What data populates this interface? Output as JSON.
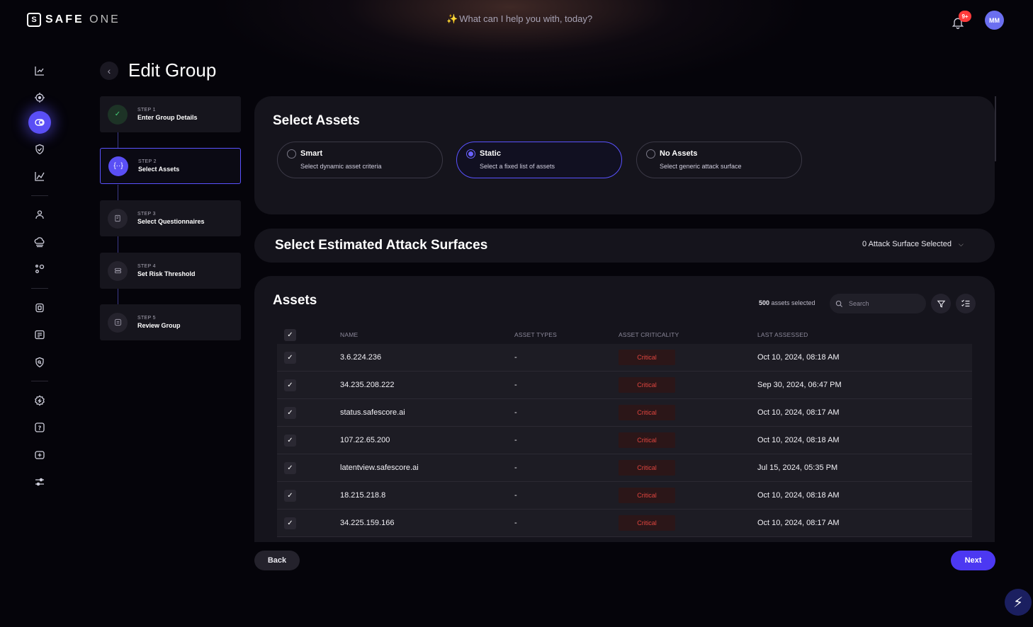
{
  "header": {
    "logo_bold": "SAFE",
    "logo_light": "ONE",
    "logo_mark": "S",
    "ask_placeholder": "What can I help you with, today?",
    "notifications_badge": "9+",
    "avatar_initials": "MM"
  },
  "sidebar": {
    "items": [
      {
        "icon": "chart-icon"
      },
      {
        "icon": "target-icon"
      },
      {
        "icon": "toggle-icon",
        "active": true
      },
      {
        "icon": "shield-check-icon"
      },
      {
        "icon": "trend-icon"
      },
      {
        "icon": "user-icon"
      },
      {
        "icon": "cloud-icon"
      },
      {
        "icon": "nodes-icon"
      },
      {
        "icon": "chip-icon"
      },
      {
        "icon": "list-icon"
      },
      {
        "icon": "shield-search-icon"
      },
      {
        "icon": "settings-icon"
      },
      {
        "icon": "help-icon"
      },
      {
        "icon": "add-box-icon"
      },
      {
        "icon": "sliders-icon"
      }
    ]
  },
  "page": {
    "title": "Edit Group"
  },
  "steps": [
    {
      "num": "STEP 1",
      "name": "Enter Group Details",
      "state": "done"
    },
    {
      "num": "STEP 2",
      "name": "Select Assets",
      "state": "current"
    },
    {
      "num": "STEP 3",
      "name": "Select Questionnaires",
      "state": "pending"
    },
    {
      "num": "STEP 4",
      "name": "Set Risk Threshold",
      "state": "pending"
    },
    {
      "num": "STEP 5",
      "name": "Review Group",
      "state": "pending"
    }
  ],
  "select_assets": {
    "title": "Select Assets",
    "options": [
      {
        "title": "Smart",
        "desc": "Select dynamic asset criteria",
        "selected": false
      },
      {
        "title": "Static",
        "desc": "Select a fixed list of assets",
        "selected": true
      },
      {
        "title": "No Assets",
        "desc": "Select generic attack surface",
        "selected": false
      }
    ]
  },
  "attack_surfaces": {
    "title": "Select Estimated Attack Surfaces",
    "dropdown_value": "0 Attack Surface Selected"
  },
  "assets": {
    "title": "Assets",
    "selected_count": "500",
    "selected_suffix": " assets selected",
    "search_placeholder": "Search",
    "columns": [
      "NAME",
      "ASSET TYPES",
      "ASSET CRITICALITY",
      "LAST ASSESSED"
    ],
    "rows": [
      {
        "name": "3.6.224.236",
        "type": "-",
        "criticality": "Critical",
        "assessed": "Oct 10, 2024, 08:18 AM"
      },
      {
        "name": "34.235.208.222",
        "type": "-",
        "criticality": "Critical",
        "assessed": "Sep 30, 2024, 06:47 PM"
      },
      {
        "name": "status.safescore.ai",
        "type": "-",
        "criticality": "Critical",
        "assessed": "Oct 10, 2024, 08:17 AM"
      },
      {
        "name": "107.22.65.200",
        "type": "-",
        "criticality": "Critical",
        "assessed": "Oct 10, 2024, 08:18 AM"
      },
      {
        "name": "latentview.safescore.ai",
        "type": "-",
        "criticality": "Critical",
        "assessed": "Jul 15, 2024, 05:35 PM"
      },
      {
        "name": "18.215.218.8",
        "type": "-",
        "criticality": "Critical",
        "assessed": "Oct 10, 2024, 08:18 AM"
      },
      {
        "name": "34.225.159.166",
        "type": "-",
        "criticality": "Critical",
        "assessed": "Oct 10, 2024, 08:17 AM"
      }
    ]
  },
  "footer": {
    "back_label": "Back",
    "next_label": "Next"
  },
  "colors": {
    "accent": "#5a4ff5",
    "critical": "#e0453f",
    "success": "#45d07a"
  }
}
